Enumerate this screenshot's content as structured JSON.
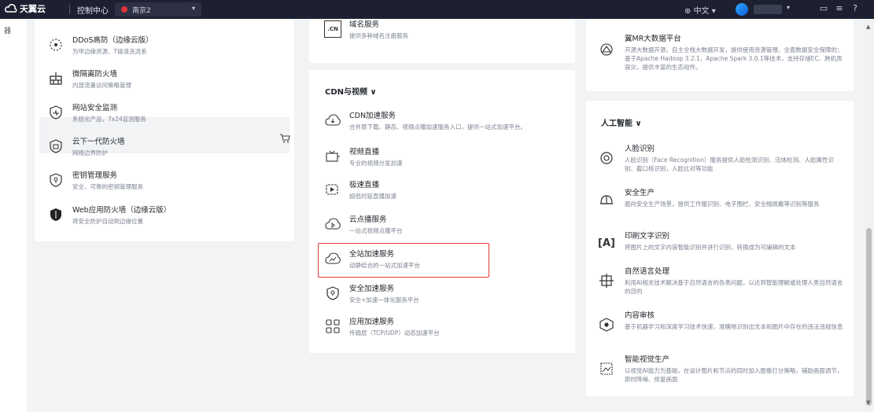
{
  "topbar": {
    "brand": "天翼云",
    "console": "控制中心",
    "region": "南京2",
    "lang": "中文",
    "colors": {
      "bg": "#1d2030",
      "region_dot": "#e2343b"
    }
  },
  "left_strip": {
    "text": "器"
  },
  "security_panel": {
    "items": [
      {
        "title": "DDoS高防（边缘云版）",
        "desc": "为甲边缘资源、T级清洗流系",
        "icon": "ddos-shield-icon"
      },
      {
        "title": "微隔离防火墙",
        "desc": "内部流量访问策略管理",
        "icon": "firewall-icon"
      },
      {
        "title": "网站安全监测",
        "desc": "系统化产品，7x24监测服务",
        "icon": "monitor-shield-icon"
      },
      {
        "title": "云下一代防火墙",
        "desc": "网络边界防护",
        "icon": "nextgen-firewall-icon"
      },
      {
        "title": "密钥管理服务",
        "desc": "安全、可靠的密钥管理服务",
        "icon": "key-shield-icon"
      },
      {
        "title": "Web应用防火墙（边缘云版）",
        "desc": "将安全防护自动到边缘位置",
        "icon": "waf-shield-icon"
      }
    ]
  },
  "domain_panel": {
    "title": "域名服务",
    "desc": "提供多种域名注册服务",
    "icon_text": ".CN"
  },
  "cdn_panel": {
    "section_title": "CDN与视频 ∨",
    "items": [
      {
        "title": "CDN加速服务",
        "desc": "合并原下载、静态、视频点播加速服务入口，提供一站式加速平台。",
        "icon": "cloud-download-icon"
      },
      {
        "title": "视频直播",
        "desc": "专业的视频分发加速",
        "icon": "live-video-icon"
      },
      {
        "title": "极速直播",
        "desc": "超低时延直播加速",
        "icon": "fast-live-icon"
      },
      {
        "title": "云点播服务",
        "desc": "一站式视频点播平台",
        "icon": "cloud-vod-icon"
      },
      {
        "title": "全站加速服务",
        "desc": "动静结合的一站式加速平台",
        "icon": "cloud-accelerate-icon"
      },
      {
        "title": "安全加速服务",
        "desc": "安全+加速一体化服务平台",
        "icon": "secure-accelerate-icon"
      },
      {
        "title": "应用加速服务",
        "desc": "传输层（TCP/UDP）动态加速平台",
        "icon": "app-accelerate-icon"
      }
    ]
  },
  "bigdata_panel": {
    "title": "翼MR大数据平台",
    "desc": "开源大数据开源，自主全栈大数据开发，提供使用资源管理、全面数据安全保障的；基于Apache Hadoop 3.2.1，Apache Spark 3.0.1等技术，支持存储EC、跨机房容灾，提供丰富的生态组件。",
    "icon": "bigdata-icon"
  },
  "ai_panel": {
    "section_title": "人工智能 ∨",
    "items": [
      {
        "title": "人脸识别",
        "desc": "人脸识别（Face Recognition）服务提供人脸检测识别、活体检测、人脸属性识别、截口核识别，人脸比对等功能",
        "icon": "face-recognition-icon"
      },
      {
        "title": "安全生产",
        "desc": "面向安全生产场景，提供工作服识别、电子围栏、安全帽佩戴等识别等服务",
        "icon": "helmet-icon"
      },
      {
        "title": "印刷文字识别",
        "desc": "将图片上的文字内容智能识别并进行识别，转换成为可编辑的文本",
        "icon": "ocr-icon"
      },
      {
        "title": "自然语言处理",
        "desc": "利用AI相关技术解决基于自然语言的各类问题，以达到智能理解或处理人类自然语言的目的",
        "icon": "nlp-icon"
      },
      {
        "title": "内容审核",
        "desc": "基于机器学习和深度学习技术快速、准确地识别出文本和图片中存在的违法违规信息",
        "icon": "content-audit-icon"
      },
      {
        "title": "智能视觉生产",
        "desc": "以视觉AI能力为基础，在设计图片和节点的同时加入图像打分策略，辅助画面调节，即时降噪、修复画面",
        "icon": "vision-production-icon"
      }
    ]
  }
}
